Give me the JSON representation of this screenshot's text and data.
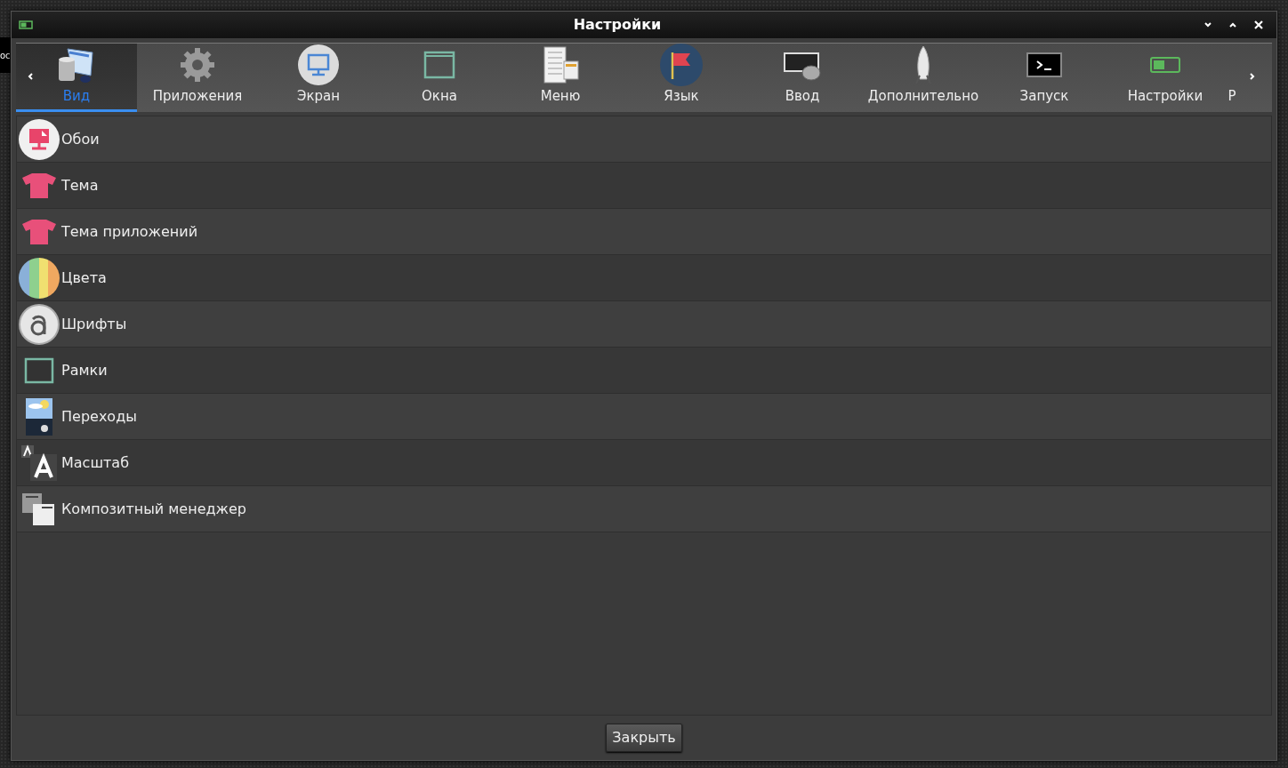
{
  "desktop": {
    "partial_text": "ос"
  },
  "window": {
    "title": "Настройки"
  },
  "tabs": [
    {
      "label": "Вид",
      "selected": true
    },
    {
      "label": "Приложения",
      "selected": false
    },
    {
      "label": "Экран",
      "selected": false
    },
    {
      "label": "Окна",
      "selected": false
    },
    {
      "label": "Меню",
      "selected": false
    },
    {
      "label": "Язык",
      "selected": false
    },
    {
      "label": "Ввод",
      "selected": false
    },
    {
      "label": "Дополнительно",
      "selected": false
    },
    {
      "label": "Запуск",
      "selected": false
    },
    {
      "label": "Настройки",
      "selected": false
    },
    {
      "label": "Р",
      "selected": false
    }
  ],
  "items": [
    {
      "label": "Обои"
    },
    {
      "label": "Тема"
    },
    {
      "label": "Тема приложений"
    },
    {
      "label": "Цвета"
    },
    {
      "label": "Шрифты"
    },
    {
      "label": "Рамки"
    },
    {
      "label": "Переходы"
    },
    {
      "label": "Масштаб"
    },
    {
      "label": "Композитный менеджер"
    }
  ],
  "buttons": [
    {
      "label": "Закрыть"
    }
  ]
}
